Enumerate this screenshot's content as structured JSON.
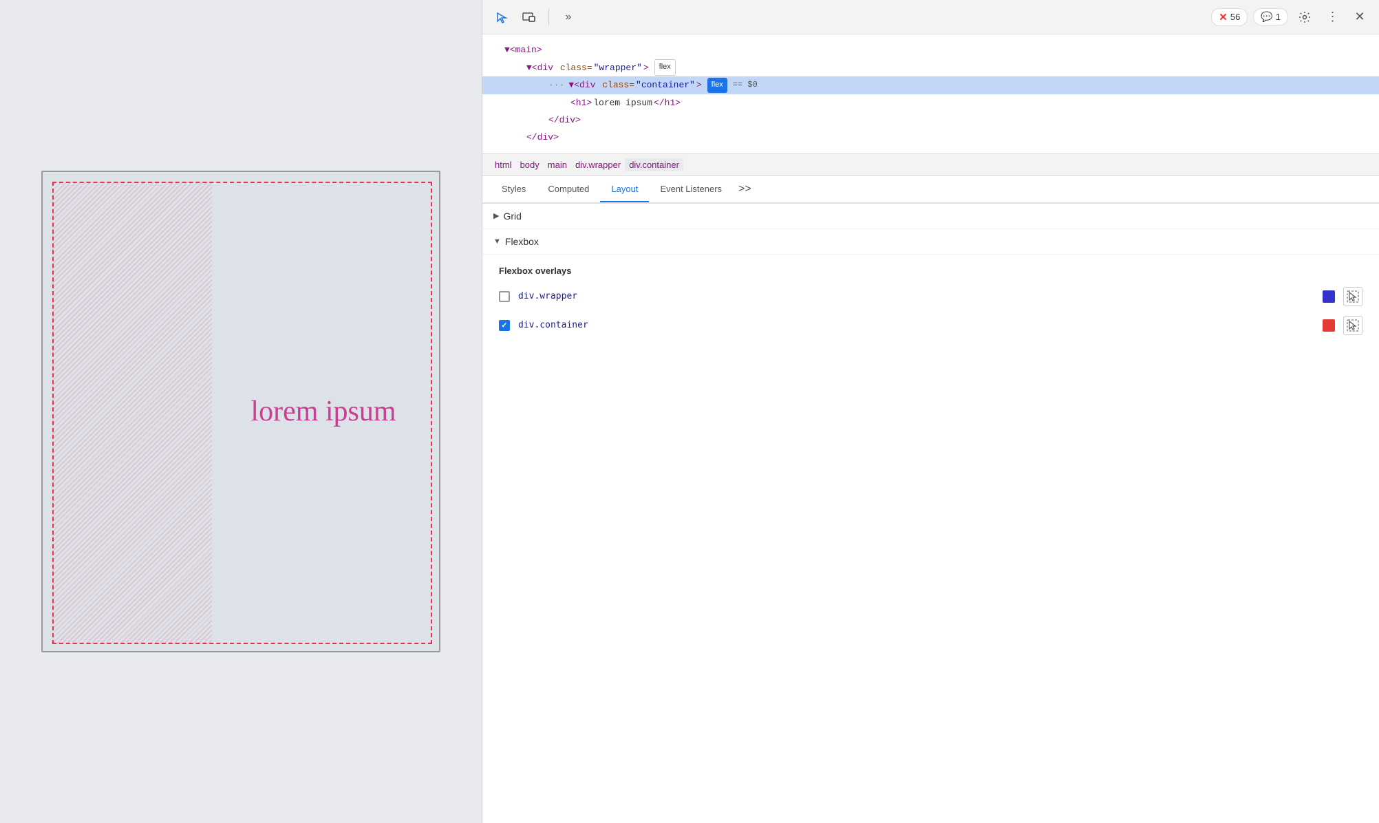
{
  "toolbar": {
    "inspect_label": "Inspect element",
    "responsive_label": "Toggle responsive mode",
    "more_label": "More tools",
    "errors_count": "56",
    "messages_count": "1",
    "settings_label": "Settings",
    "customize_label": "Customize DevTools",
    "close_label": "Close DevTools"
  },
  "dom_tree": {
    "main_open": "<main>",
    "wrapper_open": "<div class=\"wrapper\">",
    "wrapper_badge": "flex",
    "container_open": "<div class=\"container\">",
    "container_badge": "flex",
    "dollar_zero": "== $0",
    "h1": "<h1>lorem ipsum</h1>",
    "div_close": "</div>",
    "div_close2": "</div>"
  },
  "breadcrumbs": [
    {
      "label": "html",
      "active": false
    },
    {
      "label": "body",
      "active": false
    },
    {
      "label": "main",
      "active": false
    },
    {
      "label": "div.wrapper",
      "active": false
    },
    {
      "label": "div.container",
      "active": true
    }
  ],
  "tabs": [
    {
      "label": "Styles",
      "active": false
    },
    {
      "label": "Computed",
      "active": false
    },
    {
      "label": "Layout",
      "active": true
    },
    {
      "label": "Event Listeners",
      "active": false
    }
  ],
  "tabs_more": ">>",
  "sections": {
    "grid": {
      "label": "Grid",
      "expanded": false
    },
    "flexbox": {
      "label": "Flexbox",
      "expanded": true
    }
  },
  "flexbox_overlays": {
    "title": "Flexbox overlays",
    "items": [
      {
        "label": "div.wrapper",
        "checked": false,
        "color": "#3333cc"
      },
      {
        "label": "div.container",
        "checked": true,
        "color": "#e53935"
      }
    ]
  },
  "preview": {
    "lorem_text": "lorem ipsum"
  }
}
